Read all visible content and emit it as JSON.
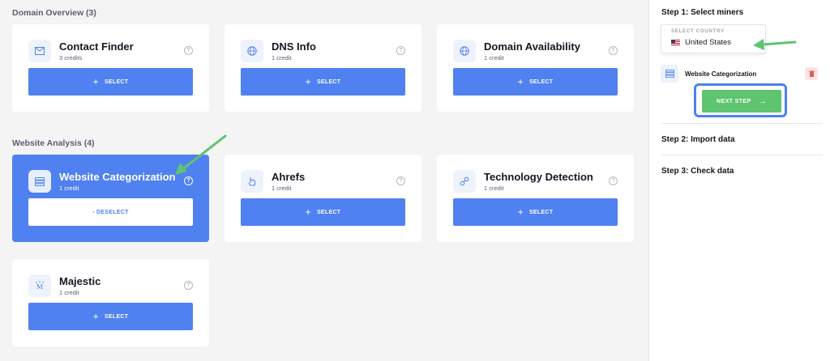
{
  "sections": {
    "domain_overview": "Domain Overview (3)",
    "website_analysis": "Website Analysis (4)"
  },
  "cards": {
    "contact_finder": {
      "title": "Contact Finder",
      "credits": "3 credits",
      "button": "SELECT",
      "icon": "envelope-icon"
    },
    "dns_info": {
      "title": "DNS Info",
      "credits": "1 credit",
      "button": "SELECT",
      "icon": "globe-icon"
    },
    "domain_availability": {
      "title": "Domain Availability",
      "credits": "1 credit",
      "button": "SELECT",
      "icon": "globe-icon"
    },
    "website_categorization": {
      "title": "Website Categorization",
      "credits": "1 credit",
      "button": "DESELECT",
      "icon": "server-list-icon",
      "selected": true
    },
    "ahrefs": {
      "title": "Ahrefs",
      "credits": "1 credit",
      "button": "SELECT",
      "icon": "ahrefs-icon"
    },
    "technology_detection": {
      "title": "Technology Detection",
      "credits": "1 credit",
      "button": "SELECT",
      "icon": "link-icon"
    },
    "majestic": {
      "title": "Majestic",
      "credits": "1 credit",
      "button": "SELECT",
      "icon": "majestic-icon"
    }
  },
  "help_glyph": "?",
  "plus_glyph": "+",
  "deselect_glyph": "-",
  "panel": {
    "step1": "Step 1: Select miners",
    "country_label": "SELECT COUNTRY",
    "country_value": "United States",
    "selected_miner": "Website Categorization",
    "next_step": "NEXT STEP",
    "step2": "Step 2: Import data",
    "step3": "Step 3: Check data"
  },
  "colors": {
    "accent": "#4f81f0",
    "success": "#5fc46f",
    "danger": "#e05a5a",
    "annotation_arrow": "#5fc46f"
  }
}
